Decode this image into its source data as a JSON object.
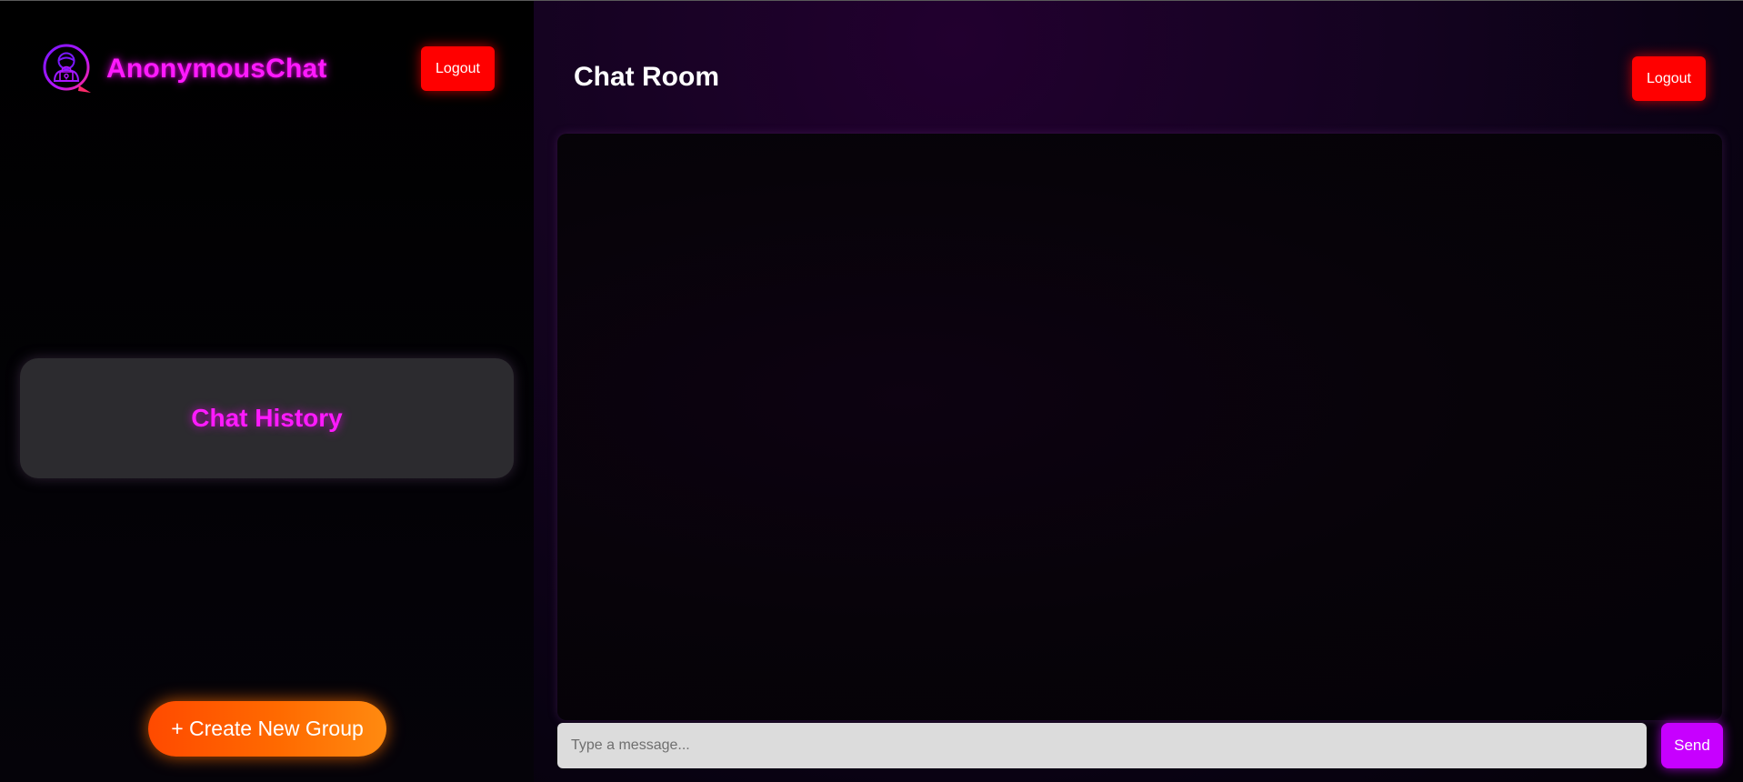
{
  "sidebar": {
    "brand_name": "AnonymousChat",
    "brand_icon": "anonymous-chat-logo-icon",
    "logout_label": "Logout",
    "history_title": "Chat History",
    "create_group_label": "+ Create New Group"
  },
  "main": {
    "title": "Chat Room",
    "logout_label": "Logout",
    "messages": [],
    "composer": {
      "placeholder": "Type a message...",
      "value": "",
      "send_label": "Send"
    }
  },
  "colors": {
    "brand_magenta": "#ff1aff",
    "logout_red": "#ff0000",
    "create_orange": "#ff6a00",
    "send_purple": "#c700ff",
    "history_card": "#2c2b2f",
    "input_bg": "#dcdcdc"
  }
}
